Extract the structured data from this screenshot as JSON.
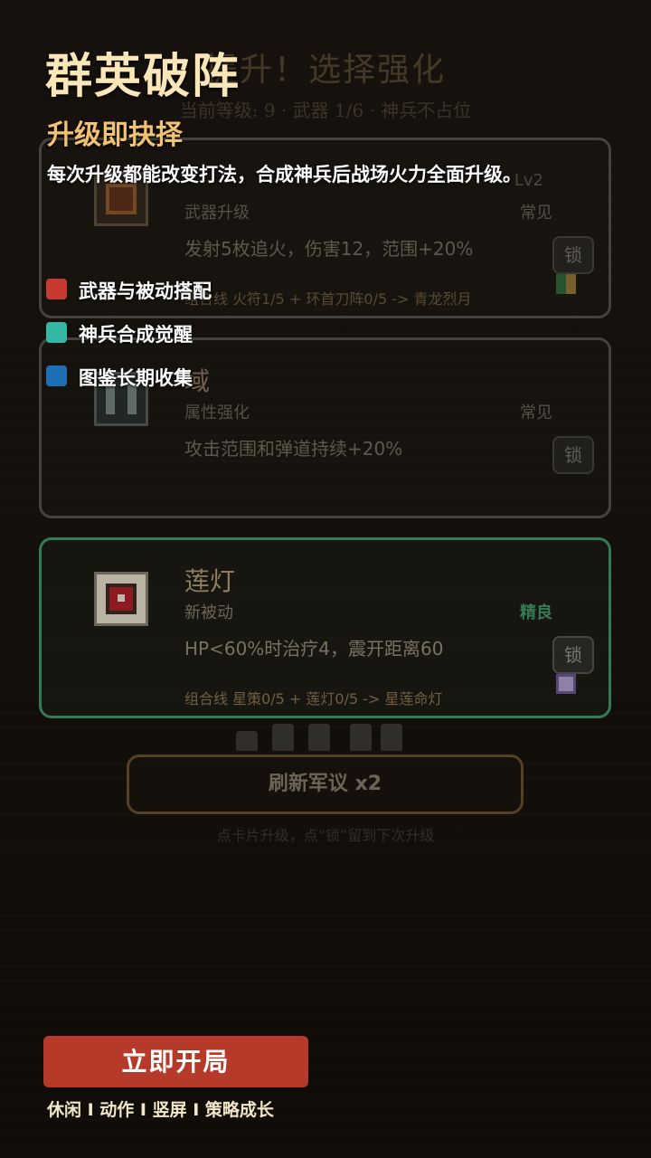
{
  "promo": {
    "title": "群英破阵",
    "subtitle": "升级即抉择",
    "description": "每次升级都能改变打法，合成神兵后战场火力全面升级。",
    "features": [
      {
        "label": "武器与被动搭配",
        "color": "#c63a32"
      },
      {
        "label": "神兵合成觉醒",
        "color": "#35b7a6"
      },
      {
        "label": "图鉴长期收集",
        "color": "#1f6fb6"
      }
    ],
    "cta_label": "立即开局",
    "tags": "休闲 I 动作 I 竖屏 I 策略成长"
  },
  "levelup": {
    "title": "提升！选择强化",
    "subtitle": "当前等级: 9 · 武器 1/6 · 神兵不占位",
    "cards": [
      {
        "name": "",
        "level": "Lv2",
        "kind": "武器升级",
        "rarity": "常见",
        "desc": "发射5枚追火，伤害12，范围+20%",
        "combo": "组合线 火符1/5 + 环首刀阵0/5 -> 青龙烈月",
        "lock_label": "锁",
        "icon": "fire-talisman-icon"
      },
      {
        "name": "域",
        "level": "",
        "kind": "属性强化",
        "rarity": "常见",
        "desc": "攻击范围和弹道持续+20%",
        "combo": "",
        "lock_label": "锁",
        "icon": "domain-icon"
      },
      {
        "name": "莲灯",
        "level": "",
        "kind": "新被动",
        "rarity": "精良",
        "desc": "HP<60%时治疗4，震开距离60",
        "combo": "组合线 星策0/5 + 莲灯0/5 -> 星莲命灯",
        "lock_label": "锁",
        "icon": "lotus-lamp-icon"
      }
    ],
    "refresh_label": "刷新军议 x2",
    "hint": "点卡片升级，点“锁”留到下次升级"
  },
  "colors": {
    "cta": "#b63a2a",
    "selected_border": "#3f9f6e",
    "title_gold": "#fbe6b8",
    "subtitle_gold": "#f2c274"
  }
}
